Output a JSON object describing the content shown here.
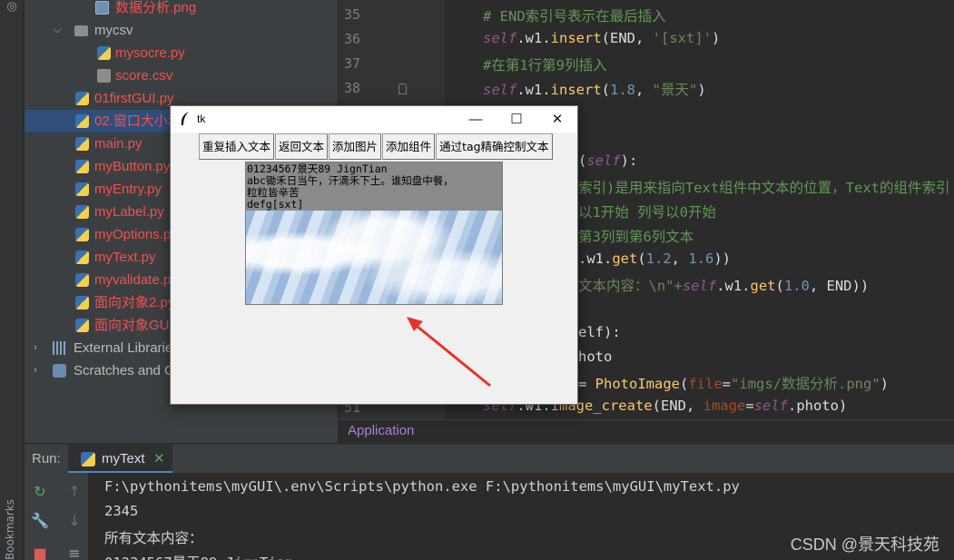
{
  "sidebar": {
    "bookmarks_label": "Bookmarks"
  },
  "project_tree": {
    "items": [
      {
        "label": "数据分析.png",
        "type": "image",
        "color": "red"
      },
      {
        "label": "mycsv",
        "type": "folder",
        "color": "plain",
        "expanded": true
      },
      {
        "label": "mysocre.py",
        "type": "python",
        "color": "red"
      },
      {
        "label": "score.csv",
        "type": "csv",
        "color": "red"
      },
      {
        "label": "01firstGUI.py",
        "type": "python",
        "color": "red"
      },
      {
        "label": "02.窗口大小和",
        "type": "python",
        "color": "red",
        "selected": true
      },
      {
        "label": "main.py",
        "type": "python",
        "color": "red"
      },
      {
        "label": "myButton.py",
        "type": "python",
        "color": "red"
      },
      {
        "label": "myEntry.py",
        "type": "python",
        "color": "red"
      },
      {
        "label": "myLabel.py",
        "type": "python",
        "color": "red"
      },
      {
        "label": "myOptions.py",
        "type": "python",
        "color": "red"
      },
      {
        "label": "myText.py",
        "type": "python",
        "color": "red"
      },
      {
        "label": "myvalidate.py",
        "type": "python",
        "color": "red"
      },
      {
        "label": "面向对象2.py",
        "type": "python",
        "color": "red"
      },
      {
        "label": "面向对象GUI.p",
        "type": "python",
        "color": "red"
      },
      {
        "label": "External Libraries",
        "type": "library",
        "color": "plain"
      },
      {
        "label": "Scratches and C",
        "type": "scratch",
        "color": "plain"
      }
    ]
  },
  "editor": {
    "line_numbers": [
      "35",
      "36",
      "37",
      "38",
      "51"
    ],
    "lines": {
      "l35": "# END索引号表示在最后插入",
      "l36_self": "self",
      "l36_rest": ".w1.",
      "l36_fn": "insert",
      "l36_args_a": "(END, ",
      "l36_str": "'[sxt]'",
      "l36_args_b": ")",
      "l37": "#在第1行第9列插入",
      "l38_self": "self",
      "l38_rest": ".w1.",
      "l38_fn": "insert",
      "l38_a": "(",
      "l38_num": "1.8",
      "l38_b": ", ",
      "l38_str": "\"景天\"",
      "l38_c": ")",
      "def_self": "(self):",
      "comment_index": "索引)是用来指向Text组件中文本的位置，Text的组件索引",
      "comment_row": "以1开始 列号以0开始",
      "comment_range": "第3列到第6列文本",
      "get_a": ".w1.",
      "get_fn": "get",
      "get_b": "(",
      "get_n1": "1.2",
      "get_c": ", ",
      "get_n2": "1.6",
      "get_d": "))",
      "all_text_a": "文本内容：\\n\"+",
      "all_text_self": "self",
      "all_text_b": ".w1.",
      "all_text_fn": "get",
      "all_text_c": "(",
      "all_text_n": "1.0",
      "all_text_d": ", END))",
      "def2": "elf):",
      "photo": "hoto",
      "photo_eq": "= ",
      "photo_cls": "PhotoImage",
      "photo_b": "(",
      "photo_param": "file",
      "photo_c": "=",
      "photo_str": "\"imgs/数据分析.png\"",
      "photo_d": ")",
      "img_self": "self",
      "img_a": ".w1.",
      "img_fn": "image_create",
      "img_b": "(END, ",
      "img_param": "image",
      "img_c": "=",
      "img_self2": "self",
      "img_d": ".photo)"
    },
    "breadcrumb": "Application"
  },
  "run_panel": {
    "title": "Run:",
    "tab_label": "myText",
    "console_lines": [
      "F:\\pythonitems\\myGUI\\.env\\Scripts\\python.exe F:\\pythonitems\\myGUI\\myText.py",
      "2345",
      "所有文本内容：",
      "01234567景天89 JignTian"
    ]
  },
  "tk_window": {
    "title": "tk",
    "buttons": [
      "重复插入文本",
      "返回文本",
      "添加图片",
      "添加组件",
      "通过tag精确控制文本"
    ],
    "text_lines": [
      "01234567景天89 JignTian",
      "abc锄禾日当午，汗滴禾下土。谁知盘中餐，",
      "粒粒皆辛苦",
      "defg[sxt]"
    ]
  },
  "watermark": "CSDN @景天科技苑",
  "colors": {
    "accent": "#4a88c7",
    "modified_file": "#f0524f",
    "arrow": "#e8332a"
  }
}
